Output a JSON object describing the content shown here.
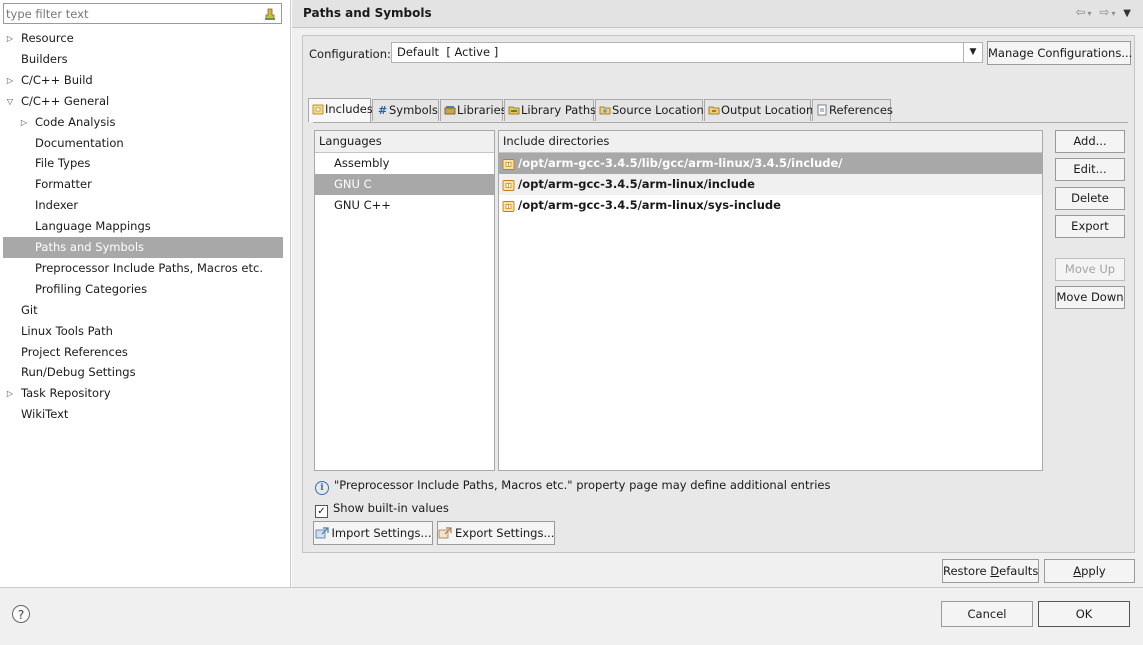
{
  "filter": {
    "placeholder": "type filter text"
  },
  "tree": [
    {
      "label": "Resource",
      "expander": "closed",
      "indent": 0
    },
    {
      "label": "Builders",
      "expander": "none",
      "indent": 0
    },
    {
      "label": "C/C++ Build",
      "expander": "closed",
      "indent": 0
    },
    {
      "label": "C/C++ General",
      "expander": "open",
      "indent": 0
    },
    {
      "label": "Code Analysis",
      "expander": "closed",
      "indent": 1
    },
    {
      "label": "Documentation",
      "expander": "none",
      "indent": 1
    },
    {
      "label": "File Types",
      "expander": "none",
      "indent": 1
    },
    {
      "label": "Formatter",
      "expander": "none",
      "indent": 1
    },
    {
      "label": "Indexer",
      "expander": "none",
      "indent": 1
    },
    {
      "label": "Language Mappings",
      "expander": "none",
      "indent": 1
    },
    {
      "label": "Paths and Symbols",
      "expander": "none",
      "indent": 1,
      "selected": true
    },
    {
      "label": "Preprocessor Include Paths, Macros etc.",
      "expander": "none",
      "indent": 1
    },
    {
      "label": "Profiling Categories",
      "expander": "none",
      "indent": 1
    },
    {
      "label": "Git",
      "expander": "none",
      "indent": 0
    },
    {
      "label": "Linux Tools Path",
      "expander": "none",
      "indent": 0
    },
    {
      "label": "Project References",
      "expander": "none",
      "indent": 0
    },
    {
      "label": "Run/Debug Settings",
      "expander": "none",
      "indent": 0
    },
    {
      "label": "Task Repository",
      "expander": "closed",
      "indent": 0
    },
    {
      "label": "WikiText",
      "expander": "none",
      "indent": 0
    }
  ],
  "page": {
    "title": "Paths and Symbols",
    "configuration_label": "Configuration:",
    "configuration_value": "Default  [ Active ]",
    "manage_button": "Manage Configurations..."
  },
  "tabs": [
    {
      "label": "Includes",
      "icon": "includes-icon",
      "active": true
    },
    {
      "label": "Symbols",
      "icon": "hash-icon"
    },
    {
      "label": "Libraries",
      "icon": "library-icon"
    },
    {
      "label": "Library Paths",
      "icon": "library-path-icon"
    },
    {
      "label": "Source Location",
      "icon": "source-folder-icon"
    },
    {
      "label": "Output Location",
      "icon": "output-folder-icon"
    },
    {
      "label": "References",
      "icon": "references-icon"
    }
  ],
  "languages": {
    "header": "Languages",
    "items": [
      {
        "label": "Assembly"
      },
      {
        "label": "GNU C",
        "selected": true
      },
      {
        "label": "GNU C++"
      }
    ]
  },
  "includes": {
    "header": "Include directories",
    "items": [
      {
        "path": "/opt/arm-gcc-3.4.5/lib/gcc/arm-linux/3.4.5/include/",
        "selected": true
      },
      {
        "path": "/opt/arm-gcc-3.4.5/arm-linux/include"
      },
      {
        "path": "/opt/arm-gcc-3.4.5/arm-linux/sys-include"
      }
    ]
  },
  "side_buttons": {
    "add": "Add...",
    "edit": "Edit...",
    "delete": "Delete",
    "export": "Export",
    "move_up": "Move Up",
    "move_down": "Move Down"
  },
  "info_text": "\"Preprocessor Include Paths, Macros etc.\" property page may define additional entries",
  "show_builtin": {
    "label": "Show built-in values",
    "checked": true
  },
  "import_settings": "Import Settings...",
  "export_settings": "Export Settings...",
  "restore_defaults": {
    "pre": "Restore ",
    "mnemonic": "D",
    "post": "efaults"
  },
  "apply": {
    "mnemonic": "A",
    "post": "pply"
  },
  "cancel": "Cancel",
  "ok": "OK",
  "colors": {
    "selection": "#a8a8a8",
    "info": "#3a6fb0",
    "include_icon": "#e0a020"
  }
}
